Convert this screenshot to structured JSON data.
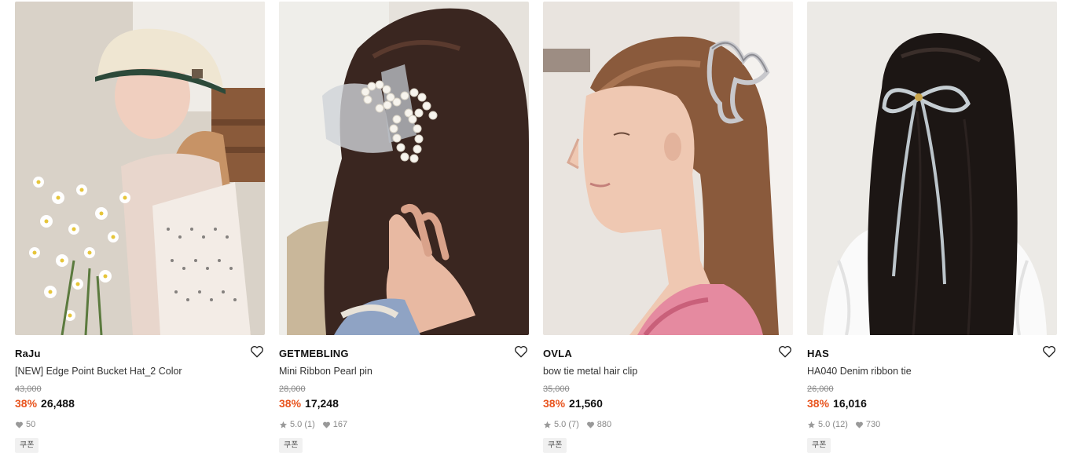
{
  "products": [
    {
      "brand": "RaJu",
      "name": "[NEW] Edge Point Bucket Hat_2 Color",
      "original_price": "43,000",
      "discount": "38%",
      "sale_price": "26,488",
      "rating": "",
      "likes": "50",
      "badge": "쿠폰"
    },
    {
      "brand": "GETMEBLING",
      "name": "Mini Ribbon Pearl pin",
      "original_price": "28,000",
      "discount": "38%",
      "sale_price": "17,248",
      "rating": "5.0 (1)",
      "likes": "167",
      "badge": "쿠폰"
    },
    {
      "brand": "OVLA",
      "name": "bow tie metal hair clip",
      "original_price": "35,000",
      "discount": "38%",
      "sale_price": "21,560",
      "rating": "5.0 (7)",
      "likes": "880",
      "badge": "쿠폰"
    },
    {
      "brand": "HAS",
      "name": "HA040 Denim ribbon tie",
      "original_price": "26,000",
      "discount": "38%",
      "sale_price": "16,016",
      "rating": "5.0 (12)",
      "likes": "730",
      "badge": "쿠폰"
    }
  ],
  "colors": {
    "discount": "#e8541e",
    "meta": "#888888",
    "badge_bg": "#f1f1f1"
  },
  "icons": {
    "wishlist": "heart-outline-icon",
    "rating": "star-icon",
    "likes": "heart-filled-icon"
  }
}
